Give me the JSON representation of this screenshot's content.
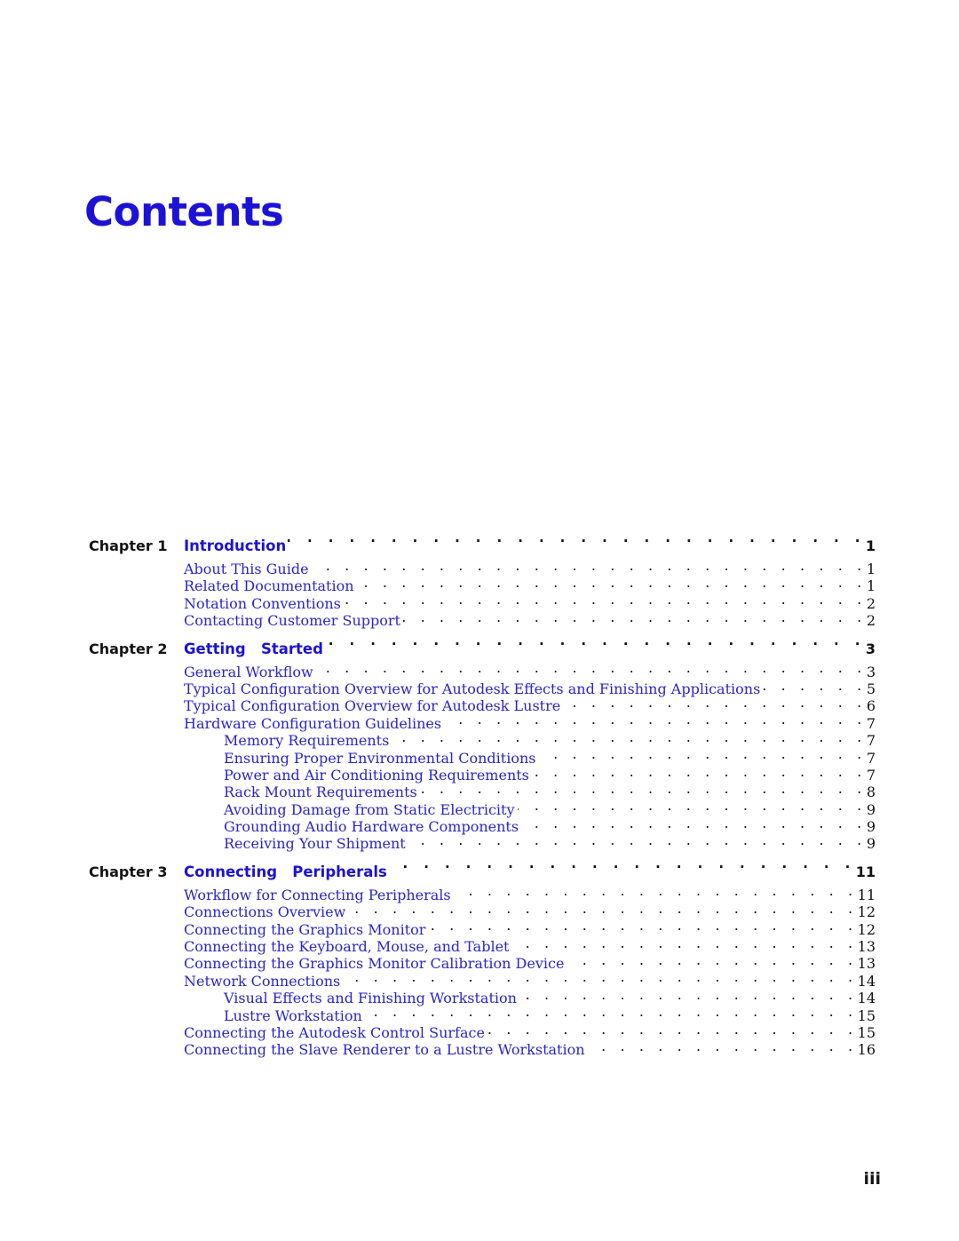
{
  "document": {
    "title": "Contents",
    "folio": "iii"
  },
  "toc": {
    "chapter_label_prefix": "Chapter",
    "chapters": [
      {
        "label": "Chapter 1",
        "title": "Introduction",
        "page": "1",
        "sections": [
          {
            "level": 1,
            "title": "About This Guide",
            "page": "1"
          },
          {
            "level": 1,
            "title": "Related Documentation",
            "page": "1"
          },
          {
            "level": 1,
            "title": "Notation Conventions",
            "page": "2"
          },
          {
            "level": 1,
            "title": "Contacting Customer Support",
            "page": "2"
          }
        ]
      },
      {
        "label": "Chapter 2",
        "title": "Getting   Started",
        "page": "3",
        "sections": [
          {
            "level": 1,
            "title": "General Workflow",
            "page": "3"
          },
          {
            "level": 1,
            "title": "Typical Configuration Overview for Autodesk Effects and Finishing Applications",
            "page": "5"
          },
          {
            "level": 1,
            "title": "Typical Configuration Overview for Autodesk Lustre",
            "page": "6"
          },
          {
            "level": 1,
            "title": "Hardware Configuration Guidelines",
            "page": "7"
          },
          {
            "level": 2,
            "title": "Memory Requirements",
            "page": "7"
          },
          {
            "level": 2,
            "title": "Ensuring Proper Environmental Conditions",
            "page": "7"
          },
          {
            "level": 2,
            "title": "Power and Air Conditioning Requirements",
            "page": "7"
          },
          {
            "level": 2,
            "title": "Rack Mount Requirements",
            "page": "8"
          },
          {
            "level": 2,
            "title": "Avoiding Damage from Static Electricity",
            "page": "9"
          },
          {
            "level": 2,
            "title": "Grounding Audio Hardware Components",
            "page": "9"
          },
          {
            "level": 2,
            "title": "Receiving Your Shipment",
            "page": "9"
          }
        ]
      },
      {
        "label": "Chapter 3",
        "title": "Connecting   Peripherals",
        "page": "11",
        "sections": [
          {
            "level": 1,
            "title": "Workflow for Connecting Peripherals",
            "page": "11"
          },
          {
            "level": 1,
            "title": "Connections Overview",
            "page": "12"
          },
          {
            "level": 1,
            "title": "Connecting the Graphics Monitor",
            "page": "12"
          },
          {
            "level": 1,
            "title": "Connecting the Keyboard, Mouse, and Tablet",
            "page": "13"
          },
          {
            "level": 1,
            "title": "Connecting the Graphics Monitor Calibration Device",
            "page": "13"
          },
          {
            "level": 1,
            "title": "Network Connections",
            "page": "14"
          },
          {
            "level": 2,
            "title": "Visual Effects and Finishing Workstation",
            "page": "14"
          },
          {
            "level": 2,
            "title": "Lustre Workstation",
            "page": "15"
          },
          {
            "level": 1,
            "title": "Connecting the Autodesk Control Surface",
            "page": "15"
          },
          {
            "level": 1,
            "title": "Connecting the Slave Renderer to a Lustre Workstation",
            "page": "16"
          }
        ]
      }
    ]
  },
  "colors": {
    "link_blue": "#2a25cc",
    "heading_blue": "#1c12d6",
    "text_black": "#111111"
  }
}
